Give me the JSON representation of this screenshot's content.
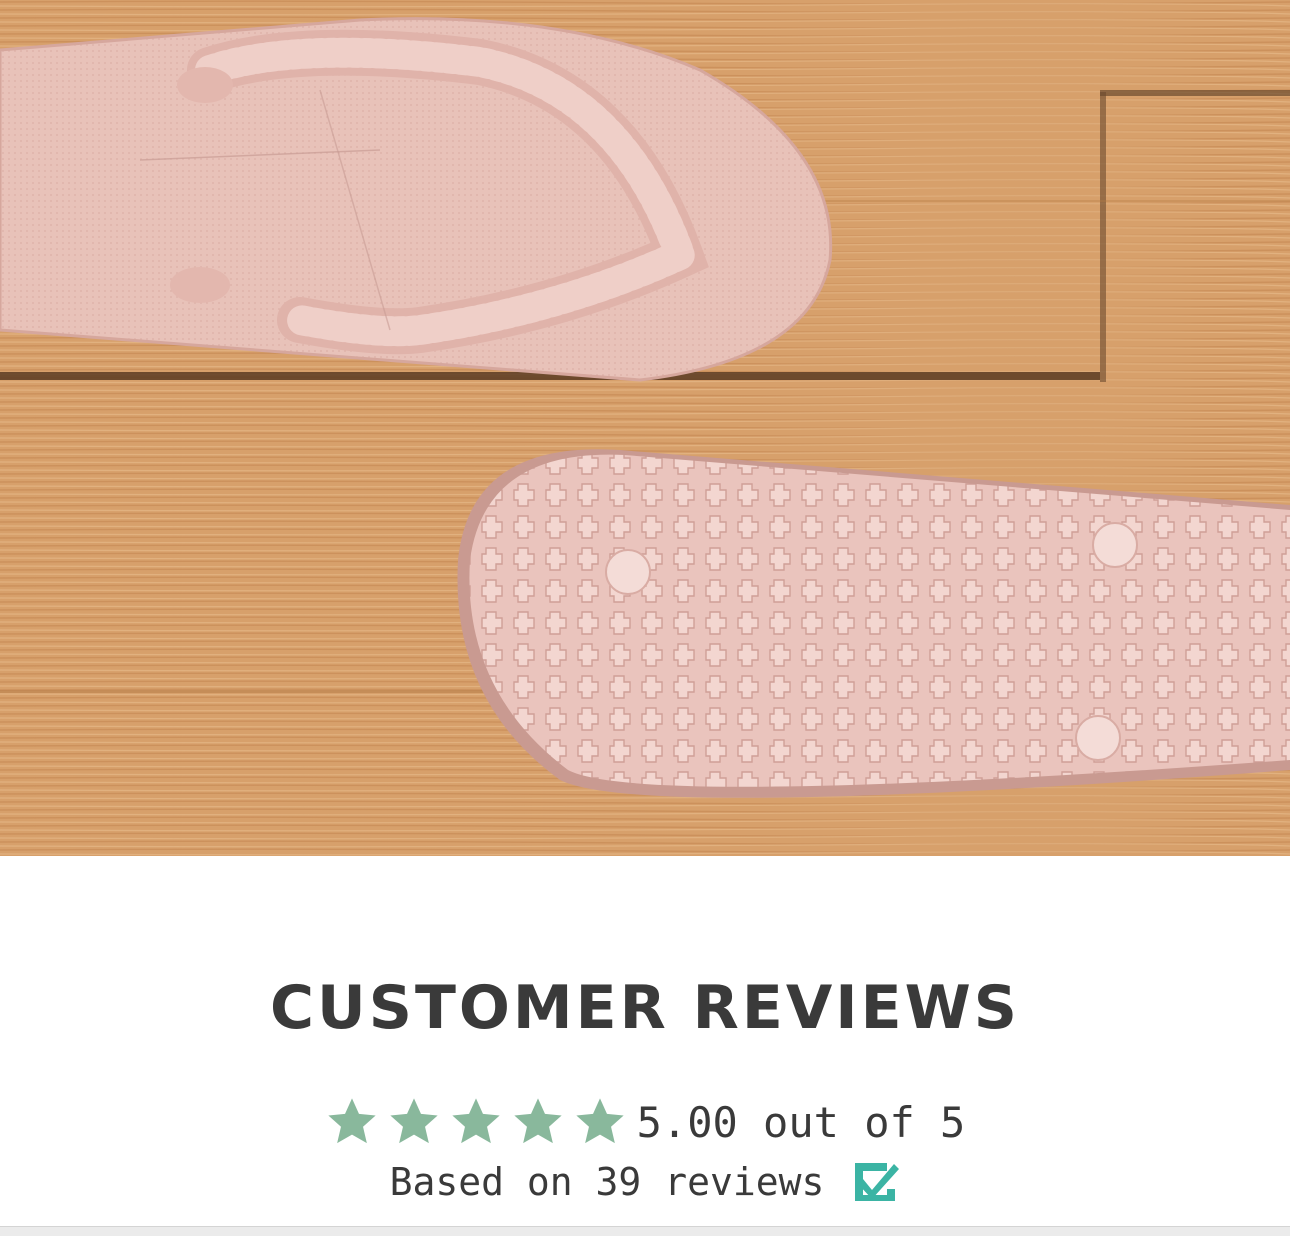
{
  "hero": {
    "image_subject": "pink flip flops on wooden floor",
    "colors": {
      "wood": "#d9a06a",
      "sandal": "#e9c3bb"
    }
  },
  "reviews": {
    "title": "CUSTOMER REVIEWS",
    "rating_text": "5.00 out of 5",
    "rating_value": 5.0,
    "rating_max": 5,
    "stars_filled": 5,
    "based_on_text": "Based on 39 reviews",
    "review_count": 39,
    "verified_badge": "verified-check-icon",
    "colors": {
      "star": "#89b89c",
      "text": "#3a3a3a",
      "badge": "#3bb4a4"
    }
  }
}
